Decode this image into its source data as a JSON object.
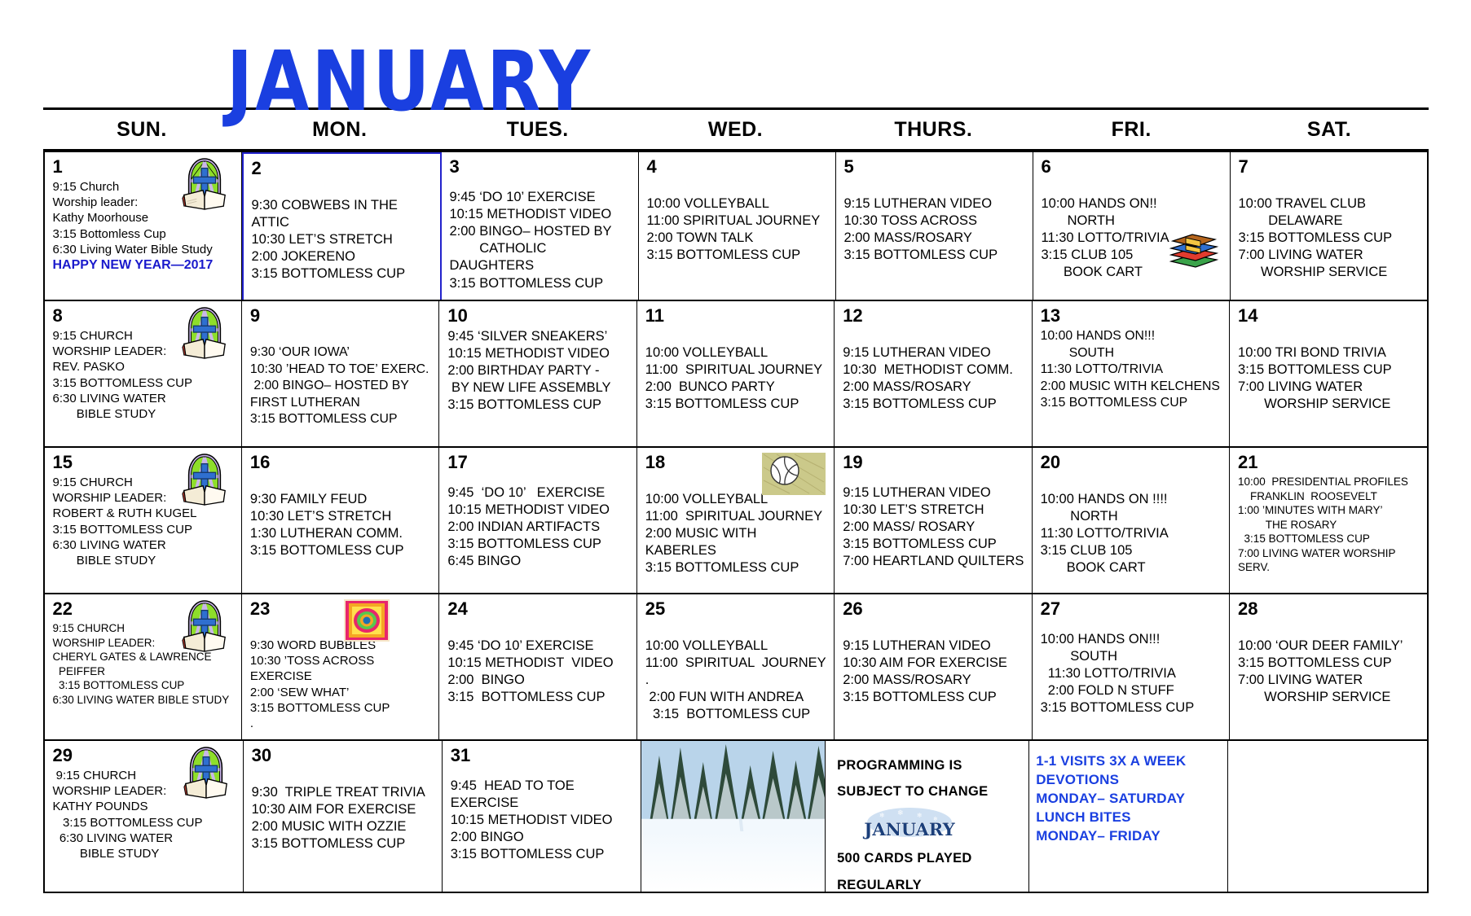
{
  "header": {
    "month_title": "JANUARY",
    "weekdays": [
      "SUN.",
      "MON.",
      "TUES.",
      "WED.",
      "THURS.",
      "FRI.",
      "SAT."
    ]
  },
  "colors": {
    "title_blue": "#1a3fe0",
    "note_blue": "#1a3fe0",
    "highlight_border": "#2222cc",
    "grid_black": "#000000"
  },
  "weeks": [
    {
      "days": [
        {
          "num": "1",
          "events": "9:15 Church\nWorship leader:\nKathy Moorhouse\n3:15 Bottomless Cup\n6:30 Living Water Bible Study",
          "extra_blue": "HAPPY NEW YEAR—2017",
          "icon": "church-bible-icon"
        },
        {
          "num": "2",
          "events": "9:30 COBWEBS IN THE ATTIC\n10:30 LET’S STRETCH\n2:00 JOKERENO\n3:15 BOTTOMLESS CUP"
        },
        {
          "num": "3",
          "events": "9:45 ‘DO 10’ EXERCISE\n10:15 METHODIST VIDEO\n2:00 BINGO– HOSTED BY\n        CATHOLIC DAUGHTERS\n3:15 BOTTOMLESS CUP"
        },
        {
          "num": "4",
          "events": "10:00 VOLLEYBALL\n11:00 SPIRITUAL JOURNEY\n2:00 TOWN TALK\n3:15 BOTTOMLESS CUP"
        },
        {
          "num": "5",
          "events": "9:15 LUTHERAN VIDEO\n10:30 TOSS ACROSS\n2:00 MASS/ROSARY\n3:15 BOTTOMLESS CUP"
        },
        {
          "num": "6",
          "events": "10:00 HANDS ON!!\n       NORTH\n11:30 LOTTO/TRIVIA\n3:15 CLUB 105\n      BOOK CART",
          "icon": "book-stack-icon"
        },
        {
          "num": "7",
          "events": "10:00 TRAVEL CLUB\n        DELAWARE\n3:15 BOTTOMLESS CUP\n7:00 LIVING WATER\n      WORSHIP SERVICE"
        }
      ]
    },
    {
      "days": [
        {
          "num": "8",
          "events": "9:15 CHURCH\nWORSHIP LEADER:\nREV. PASKO\n3:15 BOTTOMLESS CUP\n6:30 LIVING WATER\n       BIBLE STUDY",
          "icon": "church-bible-icon"
        },
        {
          "num": "9",
          "events": "9:30 ‘OUR IOWA’\n10:30 ’HEAD TO TOE’ EXERC.\n 2:00 BINGO– HOSTED BY\nFIRST LUTHERAN\n3:15 BOTTOMLESS CUP"
        },
        {
          "num": "10",
          "events": "9:45 ‘SILVER SNEAKERS’\n10:15 METHODIST VIDEO\n2:00 BIRTHDAY PARTY -\n BY NEW LIFE ASSEMBLY\n3:15 BOTTOMLESS CUP"
        },
        {
          "num": "11",
          "events": "10:00 VOLLEYBALL\n11:00  SPIRITUAL JOURNEY\n2:00  BUNCO PARTY\n3:15 BOTTOMLESS CUP"
        },
        {
          "num": "12",
          "events": "9:15 LUTHERAN VIDEO\n10:30  METHODIST COMM.\n2:00 MASS/ROSARY\n3:15 BOTTOMLESS CUP"
        },
        {
          "num": "13",
          "events": "10:00 HANDS ON!!!\n        SOUTH\n11:30 LOTTO/TRIVIA\n2:00 MUSIC WITH KELCHENS\n3:15 BOTTOMLESS CUP"
        },
        {
          "num": "14",
          "events": "10:00 TRI BOND TRIVIA\n3:15 BOTTOMLESS CUP\n7:00 LIVING WATER\n       WORSHIP SERVICE"
        }
      ]
    },
    {
      "days": [
        {
          "num": "15",
          "events": "9:15 CHURCH\nWORSHIP LEADER:\nROBERT & RUTH KUGEL\n3:15 BOTTOMLESS CUP\n6:30 LIVING WATER\n       BIBLE STUDY",
          "icon": "church-bible-icon"
        },
        {
          "num": "16",
          "events": "9:30 FAMILY FEUD\n10:30 LET’S STRETCH\n1:30 LUTHERAN COMM.\n3:15 BOTTOMLESS CUP"
        },
        {
          "num": "17",
          "events": "9:45  ‘DO 10’   EXERCISE\n10:15 METHODIST VIDEO\n2:00 INDIAN ARTIFACTS\n3:15 BOTTOMLESS CUP\n6:45 BINGO"
        },
        {
          "num": "18",
          "events": "10:00 VOLLEYBALL\n11:00  SPIRITUAL JOURNEY\n2:00 MUSIC WITH KABERLES\n3:15 BOTTOMLESS CUP",
          "icon": "volleyball-icon"
        },
        {
          "num": "19",
          "events": "9:15 LUTHERAN VIDEO\n10:30 LET’S STRETCH\n2:00 MASS/ ROSARY\n3:15 BOTTOMLESS CUP\n7:00 HEARTLAND QUILTERS"
        },
        {
          "num": "20",
          "events": "10:00 HANDS ON !!!!\n        NORTH\n11:30 LOTTO/TRIVIA\n3:15 CLUB 105\n       BOOK CART"
        },
        {
          "num": "21",
          "events": "10:00  PRESIDENTIAL PROFILES\n    FRANKLIN  ROOSEVELT\n1:00 ’MINUTES WITH MARY’\n         THE ROSARY\n  3:15 BOTTOMLESS CUP\n7:00 LIVING WATER WORSHIP SERV."
        }
      ]
    },
    {
      "days": [
        {
          "num": "22",
          "events": "9:15 CHURCH\nWORSHIP LEADER:\nCHERYL GATES & LAWRENCE\n  PEIFFER\n  3:15 BOTTOMLESS CUP\n6:30 LIVING WATER BIBLE STUDY",
          "icon": "church-bible-icon"
        },
        {
          "num": "23",
          "events": "9:30 WORD BUBBLES\n10:30 ’TOSS ACROSS EXERCISE\n2:00 ‘SEW WHAT’\n3:15 BOTTOMLESS CUP\n.",
          "icon": "quilt-icon"
        },
        {
          "num": "24",
          "events": "9:45 ‘DO 10’ EXERCISE\n10:15 METHODIST  VIDEO\n2:00  BINGO\n3:15  BOTTOMLESS CUP"
        },
        {
          "num": "25",
          "events": "10:00 VOLLEYBALL\n11:00  SPIRITUAL  JOURNEY .\n 2:00 FUN WITH ANDREA\n  3:15  BOTTOMLESS CUP"
        },
        {
          "num": "26",
          "events": "9:15 LUTHERAN VIDEO\n10:30 AIM FOR EXERCISE\n2:00 MASS/ROSARY\n3:15 BOTTOMLESS CUP"
        },
        {
          "num": "27",
          "events": "10:00 HANDS ON!!!\n        SOUTH\n  11:30 LOTTO/TRIVIA\n  2:00 FOLD N STUFF\n3:15 BOTTOMLESS CUP"
        },
        {
          "num": "28",
          "events": "10:00 ‘OUR DEER FAMILY’\n3:15 BOTTOMLESS CUP\n7:00 LIVING WATER\n       WORSHIP SERVICE"
        }
      ]
    },
    {
      "days": [
        {
          "num": "29",
          "events": " 9:15 CHURCH\nWORSHIP LEADER:\nKATHY POUNDS\n   3:15 BOTTOMLESS CUP\n  6:30 LIVING WATER\n        BIBLE STUDY",
          "icon": "church-bible-icon"
        },
        {
          "num": "30",
          "events": "9:30  TRIPLE TREAT TRIVIA\n10:30 AIM FOR EXERCISE\n2:00 MUSIC WITH OZZIE\n3:15 BOTTOMLESS CUP"
        },
        {
          "num": "31",
          "events": "9:45  HEAD TO TOE EXERCISE\n10:15 METHODIST VIDEO\n2:00 BINGO\n3:15 BOTTOMLESS CUP"
        },
        {
          "type": "photo",
          "alt": "winter-snowy-pine-trees-photo"
        },
        {
          "type": "notes-black",
          "lines": [
            "PROGRAMMING IS",
            "SUBJECT TO CHANGE"
          ],
          "logo": "january-snow-logo",
          "lines2": [
            "500 CARDS PLAYED",
            "REGULARLY"
          ]
        },
        {
          "type": "notes-blue",
          "lines": [
            "1-1 VISITS 3X A WEEK",
            "",
            "DEVOTIONS",
            "MONDAY– SATURDAY",
            "",
            "LUNCH BITES",
            "MONDAY– FRIDAY"
          ]
        },
        {
          "type": "empty"
        }
      ]
    }
  ]
}
